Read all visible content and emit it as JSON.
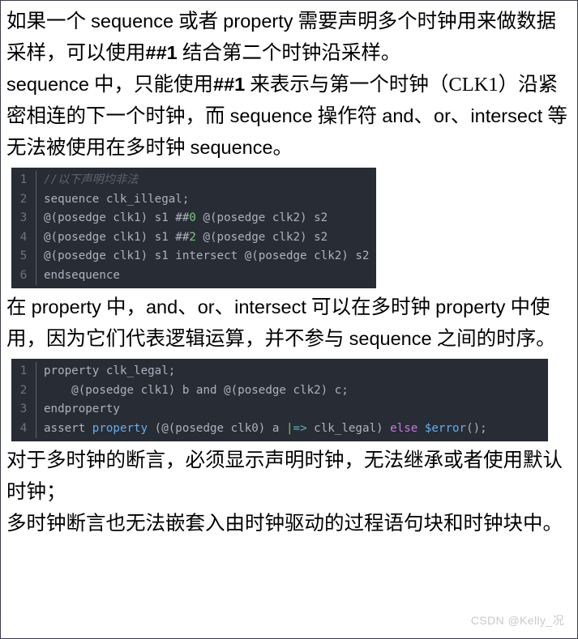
{
  "document": {
    "watermark": "CSDN @Kelly_况",
    "paragraphs": {
      "p1_line1_a": "如果一个",
      "p1_line1_b": "sequence",
      "p1_line1_c": "或者",
      "p1_line1_d": "property",
      "p1_line1_e": "需要声明多个时钟用来做数据采样，可以使用",
      "p1_line1_f": "##1",
      "p1_line1_g": "结合第二个时钟沿采样。",
      "p1_line2_a": "sequence",
      "p1_line2_b": "中，只能使用",
      "p1_line2_c": "##1",
      "p1_line2_d": "来表示与第一个时钟（CLK1）沿紧密相连的下一个时钟，而",
      "p1_line2_e": "sequence",
      "p1_line2_f": "操作符",
      "p1_line2_g": "and",
      "p1_line2_h": "、",
      "p1_line2_i": "or",
      "p1_line2_j": "、",
      "p1_line2_k": "intersect",
      "p1_line2_l": "等无法被使用在多时钟",
      "p1_line2_m": "sequence",
      "p1_line2_n": "。",
      "p2_a": "在",
      "p2_b": "property",
      "p2_c": "中，",
      "p2_d": "and",
      "p2_e": "、",
      "p2_f": "or",
      "p2_g": "、",
      "p2_h": "intersect",
      "p2_i": "可以在多时钟",
      "p2_j": "property",
      "p2_k": "中使用，因为它们代表逻辑运算，并不参与",
      "p2_l": "sequence",
      "p2_m": "之间的时序。",
      "p3_a": "对于多时钟的断言，必须显示声明时钟，无法继承或者使用默认时钟；",
      "p3_b": "多时钟断言也无法嵌套入由时钟驱动的过程语句块和时钟块中。"
    }
  },
  "code_block_1": {
    "background": "#282c34",
    "lines": [
      {
        "num": "1",
        "tokens": [
          {
            "text": "//以下声明均非法",
            "cls": "t-com"
          }
        ]
      },
      {
        "num": "2",
        "tokens": [
          {
            "text": "sequence clk_illegal;",
            "cls": "t-def"
          }
        ]
      },
      {
        "num": "3",
        "tokens": [
          {
            "text": "@(posedge clk1) s1 ##",
            "cls": "t-def"
          },
          {
            "text": "0",
            "cls": "t-num"
          },
          {
            "text": " @(posedge clk2) s2",
            "cls": "t-def"
          }
        ]
      },
      {
        "num": "4",
        "tokens": [
          {
            "text": "@(posedge clk1) s1 ##",
            "cls": "t-def"
          },
          {
            "text": "2",
            "cls": "t-num"
          },
          {
            "text": " @(posedge clk2) s2",
            "cls": "t-def"
          }
        ]
      },
      {
        "num": "5",
        "tokens": [
          {
            "text": "@(posedge clk1) s1 intersect @(posedge clk2) s2",
            "cls": "t-def"
          }
        ]
      },
      {
        "num": "6",
        "tokens": [
          {
            "text": "endsequence",
            "cls": "t-def"
          }
        ]
      }
    ]
  },
  "code_block_2": {
    "background": "#282c34",
    "lines": [
      {
        "num": "1",
        "tokens": [
          {
            "text": "property clk_legal;",
            "cls": "t-def"
          }
        ]
      },
      {
        "num": "2",
        "tokens": [
          {
            "text": "    @(posedge clk1) b and @(posedge clk2) c;",
            "cls": "t-def"
          }
        ]
      },
      {
        "num": "3",
        "tokens": [
          {
            "text": "endproperty",
            "cls": "t-def"
          }
        ]
      },
      {
        "num": "4",
        "tokens": [
          {
            "text": "assert ",
            "cls": "t-def"
          },
          {
            "text": "property",
            "cls": "t-kw"
          },
          {
            "text": " (@(posedge clk0) a ",
            "cls": "t-def"
          },
          {
            "text": "|",
            "cls": "t-pipe"
          },
          {
            "text": "=>",
            "cls": "t-op"
          },
          {
            "text": " clk_legal) ",
            "cls": "t-def"
          },
          {
            "text": "else",
            "cls": "t-else"
          },
          {
            "text": " ",
            "cls": "t-def"
          },
          {
            "text": "$error",
            "cls": "t-fn"
          },
          {
            "text": "();",
            "cls": "t-def"
          }
        ]
      }
    ]
  }
}
